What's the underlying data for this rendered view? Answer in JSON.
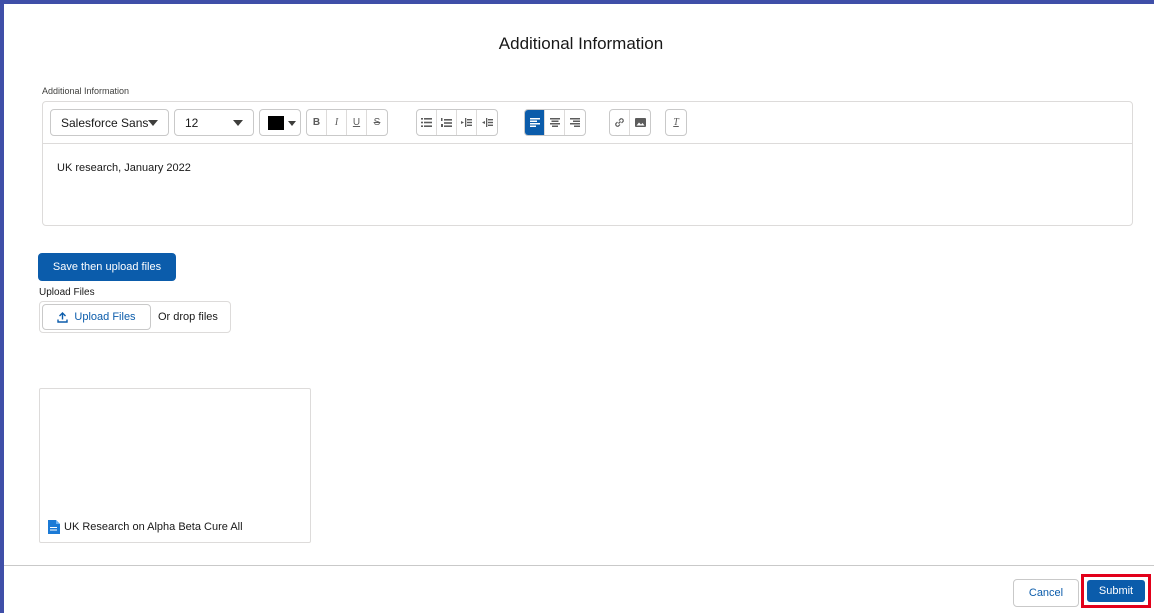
{
  "modal": {
    "title": "Additional Information"
  },
  "rich_text": {
    "label": "Additional Information",
    "font_family": "Salesforce Sans",
    "font_size": "12",
    "text_color": "#000000",
    "content": "UK research, January 2022"
  },
  "actions": {
    "save_upload_label": "Save then upload files"
  },
  "upload": {
    "label": "Upload Files",
    "button_label": "Upload Files",
    "drop_text": "Or drop files"
  },
  "files": [
    {
      "name": "UK Research on Alpha Beta Cure All"
    }
  ],
  "footer": {
    "cancel_label": "Cancel",
    "submit_label": "Submit"
  },
  "colors": {
    "brand": "#0b5cab",
    "highlight": "#e2001a",
    "window_border": "#3f4fa8"
  }
}
